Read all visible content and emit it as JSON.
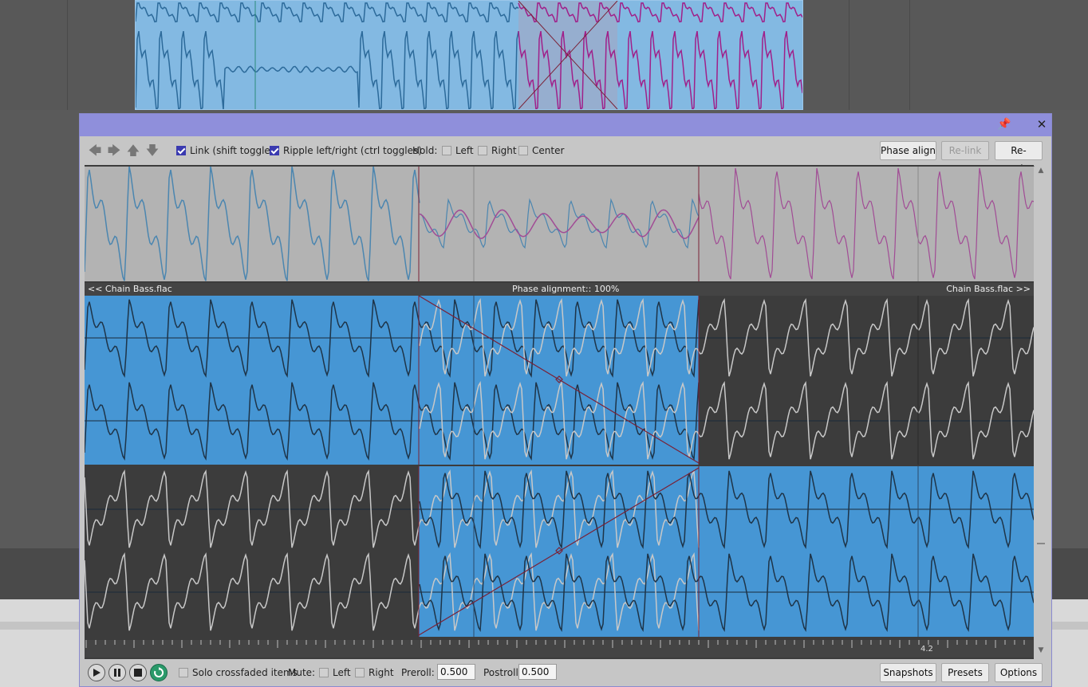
{
  "toolbar": {
    "link_label": "Link (shift toggles)",
    "link_checked": true,
    "ripple_label": "Ripple left/right (ctrl toggles)",
    "ripple_checked": true,
    "hold_label": "Hold:",
    "hold_left": "Left",
    "hold_right": "Right",
    "hold_center": "Center",
    "phase_align": "Phase align",
    "relink": "Re-link",
    "recenter": "Re-center"
  },
  "lanes": {
    "left_item": "<< Chain Bass.flac",
    "phase_status": "Phase alignment:: 100%",
    "right_item": "Chain Bass.flac >>"
  },
  "ruler": {
    "marker": "4.2"
  },
  "bottom": {
    "solo_label": "Solo crossfaded items",
    "mute_label": "Mute:",
    "mute_left": "Left",
    "mute_right": "Right",
    "preroll_label": "Preroll:",
    "preroll_value": "0.500",
    "postroll_label": "Postroll:",
    "postroll_value": "0.500",
    "snapshots": "Snapshots",
    "presets": "Presets",
    "options": "Options"
  },
  "colors": {
    "titlebar": "#8f8fdb",
    "item_blue": "#4696d4",
    "wave_blue": "#3f7fa8",
    "wave_pink": "#a0408f",
    "crossfade_line": "#7a2035"
  }
}
